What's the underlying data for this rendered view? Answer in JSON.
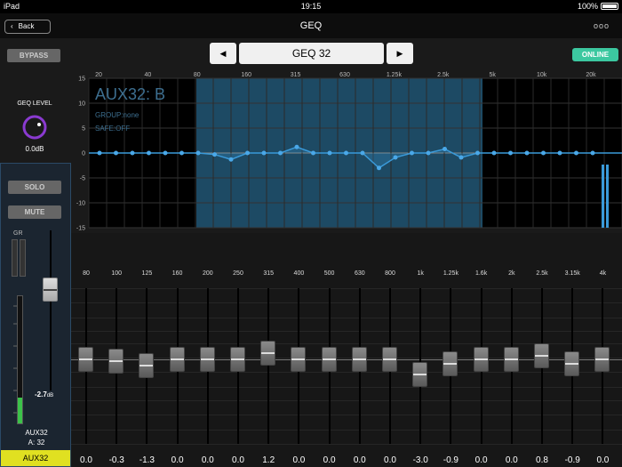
{
  "status_bar": {
    "device": "iPad",
    "time": "19:15",
    "battery": "100%"
  },
  "nav": {
    "back_label": "Back",
    "title": "GEQ",
    "more_icon": "ooo"
  },
  "bypass_label": "BYPASS",
  "geq_level": {
    "label": "GEQ LEVEL",
    "value": "0.0dB"
  },
  "selector": {
    "prev_icon": "◀",
    "name": "GEQ 32",
    "next_icon": "▶"
  },
  "online_label": "ONLINE",
  "graph": {
    "channel_name": "AUX32: B",
    "group": "GROUP:none",
    "safe": "SAFE:OFF",
    "freq_labels": [
      "20",
      "40",
      "80",
      "160",
      "315",
      "630",
      "1.25k",
      "2.5k",
      "5k",
      "10k",
      "20k"
    ],
    "db_labels": [
      "15",
      "10",
      "5",
      "0",
      "-5",
      "-10",
      "-15"
    ]
  },
  "channel_strip": {
    "solo_label": "SOLO",
    "mute_label": "MUTE",
    "gr_label": "GR",
    "fader_value": "-2.7",
    "fader_unit": "dB",
    "name": "AUX32",
    "sub": "A: 32",
    "label": "AUX32",
    "meter_level": 0.2
  },
  "bands": [
    {
      "freq": "80",
      "value": "0.0"
    },
    {
      "freq": "100",
      "value": "-0.3"
    },
    {
      "freq": "125",
      "value": "-1.3"
    },
    {
      "freq": "160",
      "value": "0.0"
    },
    {
      "freq": "200",
      "value": "0.0"
    },
    {
      "freq": "250",
      "value": "0.0"
    },
    {
      "freq": "315",
      "value": "1.2"
    },
    {
      "freq": "400",
      "value": "0.0"
    },
    {
      "freq": "500",
      "value": "0.0"
    },
    {
      "freq": "630",
      "value": "0.0"
    },
    {
      "freq": "800",
      "value": "0.0"
    },
    {
      "freq": "1k",
      "value": "-3.0"
    },
    {
      "freq": "1.25k",
      "value": "-0.9"
    },
    {
      "freq": "1.6k",
      "value": "0.0"
    },
    {
      "freq": "2k",
      "value": "0.0"
    },
    {
      "freq": "2.5k",
      "value": "0.8"
    },
    {
      "freq": "3.15k",
      "value": "-0.9"
    },
    {
      "freq": "4k",
      "value": "0.0"
    }
  ],
  "colors": {
    "accent": "#3a9ad9",
    "online": "#3cc8a0",
    "label_yellow": "#e0e021"
  }
}
